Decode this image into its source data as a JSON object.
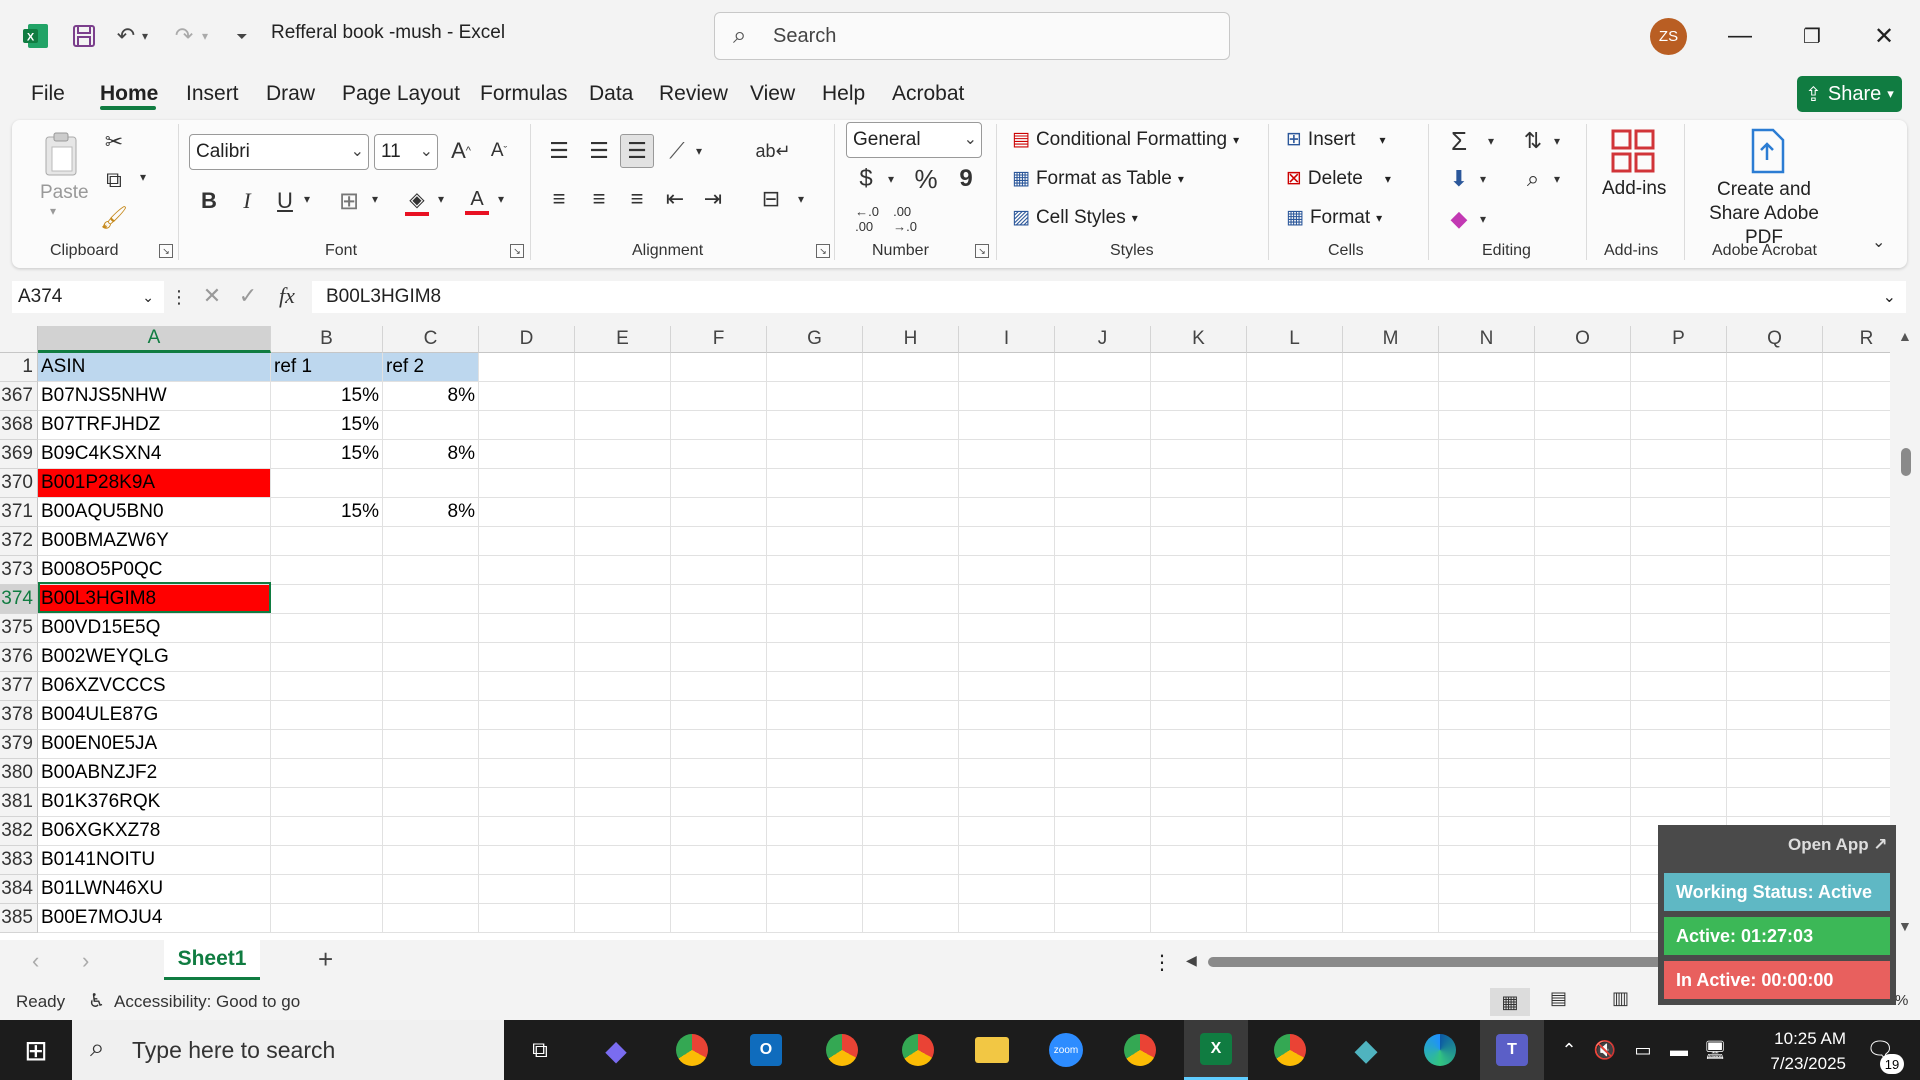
{
  "window": {
    "title": "Refferal book -mush  -  Excel",
    "search_placeholder": "Search",
    "avatar": "ZS"
  },
  "menu": [
    "File",
    "Home",
    "Insert",
    "Draw",
    "Page Layout",
    "Formulas",
    "Data",
    "Review",
    "View",
    "Help",
    "Acrobat"
  ],
  "share_label": "Share",
  "ribbon": {
    "clipboard": {
      "paste": "Paste",
      "label": "Clipboard"
    },
    "font": {
      "name": "Calibri",
      "size": "11",
      "label": "Font",
      "bold": "B",
      "italic": "I",
      "underline": "U"
    },
    "alignment": {
      "label": "Alignment"
    },
    "number": {
      "format": "General",
      "label": "Number",
      "currency": "$",
      "percent": "%",
      "comma": "9"
    },
    "styles": {
      "conditional": "Conditional Formatting",
      "table": "Format as Table",
      "cell": "Cell Styles",
      "label": "Styles"
    },
    "cells": {
      "insert": "Insert",
      "delete": "Delete",
      "format": "Format",
      "label": "Cells"
    },
    "editing": {
      "label": "Editing"
    },
    "addins": {
      "button": "Add-ins",
      "label": "Add-ins"
    },
    "acrobat": {
      "button": "Create and Share Adobe PDF",
      "label": "Adobe Acrobat"
    }
  },
  "formula_bar": {
    "name_box": "A374",
    "formula": "B00L3HGIM8",
    "fx": "fx"
  },
  "columns": [
    "A",
    "B",
    "C",
    "D",
    "E",
    "F",
    "G",
    "H",
    "I",
    "J",
    "K",
    "L",
    "M",
    "N",
    "O",
    "P",
    "Q",
    "R"
  ],
  "header_row": {
    "row": "1",
    "A": "ASIN",
    "B": "ref 1",
    "C": "ref 2"
  },
  "rows": [
    {
      "row": "367",
      "A": "B07NJS5NHW",
      "B": "15%",
      "C": "8%"
    },
    {
      "row": "368",
      "A": "B07TRFJHDZ",
      "B": "15%",
      "C": ""
    },
    {
      "row": "369",
      "A": "B09C4KSXN4",
      "B": "15%",
      "C": "8%"
    },
    {
      "row": "370",
      "A": "B001P28K9A",
      "B": "",
      "C": "",
      "red": true
    },
    {
      "row": "371",
      "A": "B00AQU5BN0",
      "B": "15%",
      "C": "8%"
    },
    {
      "row": "372",
      "A": "B00BMAZW6Y",
      "B": "",
      "C": ""
    },
    {
      "row": "373",
      "A": "B008O5P0QC",
      "B": "",
      "C": ""
    },
    {
      "row": "374",
      "A": "B00L3HGIM8",
      "B": "",
      "C": "",
      "red": true,
      "selected": true
    },
    {
      "row": "375",
      "A": "B00VD15E5Q",
      "B": "",
      "C": ""
    },
    {
      "row": "376",
      "A": "B002WEYQLG",
      "B": "",
      "C": ""
    },
    {
      "row": "377",
      "A": "B06XZVCCCS",
      "B": "",
      "C": ""
    },
    {
      "row": "378",
      "A": "B004ULE87G",
      "B": "",
      "C": ""
    },
    {
      "row": "379",
      "A": "B00EN0E5JA",
      "B": "",
      "C": ""
    },
    {
      "row": "380",
      "A": "B00ABNZJF2",
      "B": "",
      "C": ""
    },
    {
      "row": "381",
      "A": "B01K376RQK",
      "B": "",
      "C": ""
    },
    {
      "row": "382",
      "A": "B06XGKXZ78",
      "B": "",
      "C": ""
    },
    {
      "row": "383",
      "A": "B0141NOITU",
      "B": "",
      "C": ""
    },
    {
      "row": "384",
      "A": "B01LWN46XU",
      "B": "",
      "C": ""
    },
    {
      "row": "385",
      "A": "B00E7MOJU4",
      "B": "",
      "C": ""
    }
  ],
  "sheet_tab": "Sheet1",
  "status": {
    "ready": "Ready",
    "accessibility": "Accessibility: Good to go",
    "zoom": "100%"
  },
  "overlay": {
    "open_app": "Open App ↗",
    "working": "Working Status: Active",
    "active": "Active: 01:27:03",
    "inactive": "In Active: 00:00:00"
  },
  "taskbar": {
    "search_placeholder": "Type here to search",
    "time": "10:25 AM",
    "date": "7/23/2025",
    "notifications": "19"
  },
  "colors": {
    "excel_green": "#107c41",
    "highlight_red": "#ff0000",
    "header_blue": "#bdd7ee"
  }
}
